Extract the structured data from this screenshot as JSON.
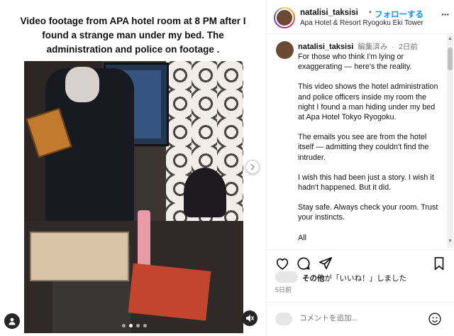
{
  "media": {
    "caption": "Video footage from APA hotel room at 8 PM after I found a strange man under my bed. The administration and police on footage .",
    "dots_total": 4,
    "dots_active_index": 1
  },
  "header": {
    "username": "natalisi_taksisi",
    "separator": "•",
    "follow_label": "フォローする",
    "location": "Apa Hotel & Resort Ryogoku Eki Tower",
    "more_label": "···"
  },
  "comment": {
    "username": "natalisi_taksisi",
    "edited": "編集済み",
    "separator": "·",
    "time": "2日前",
    "paragraphs": [
      "For those who think I'm lying or exaggerating — here's the reality.",
      "This video shows the hotel administration and police officers inside my room the night I found a man hiding under my bed at Apa Hotel Tokyo Ryogoku.",
      "The emails you see are from the hotel itself — admitting they couldn't find the intruder.",
      "I wish this had been just a story. I wish it hadn't happened. But it did.",
      "Stay safe. Always check your room. Trust your instincts.",
      "All"
    ]
  },
  "likes": {
    "bold": "その他",
    "rest": "が「いいね！」しました"
  },
  "date": "5日前",
  "comment_input": {
    "placeholder": "コメントを追加..."
  },
  "icons": {
    "like": "heart-icon",
    "comment": "comment-icon",
    "share": "send-icon",
    "save": "bookmark-icon",
    "emoji": "emoji-icon",
    "user": "user-icon",
    "mute": "mute-icon",
    "next": "chevron-right-icon"
  },
  "colors": {
    "follow": "#0095f6",
    "muted_text": "#737373"
  }
}
